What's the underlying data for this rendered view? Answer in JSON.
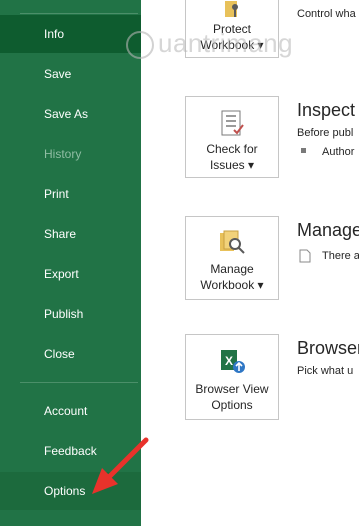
{
  "sidebar": {
    "items": [
      {
        "label": "Info"
      },
      {
        "label": "Save"
      },
      {
        "label": "Save As"
      },
      {
        "label": "History"
      },
      {
        "label": "Print"
      },
      {
        "label": "Share"
      },
      {
        "label": "Export"
      },
      {
        "label": "Publish"
      },
      {
        "label": "Close"
      },
      {
        "label": "Account"
      },
      {
        "label": "Feedback"
      },
      {
        "label": "Options"
      }
    ]
  },
  "main": {
    "protect": {
      "button_line1": "Protect",
      "button_line2": "Workbook ▾",
      "desc": "Control wha"
    },
    "inspect": {
      "button_line1": "Check for",
      "button_line2": "Issues ▾",
      "title": "Inspect",
      "desc": "Before publ",
      "bullet": "Author"
    },
    "manage": {
      "button_line1": "Manage",
      "button_line2": "Workbook ▾",
      "title": "Manage",
      "desc": "There a"
    },
    "browser": {
      "button_line1": "Browser View",
      "button_line2": "Options",
      "title": "Browser",
      "desc": "Pick what u"
    }
  },
  "watermark": "uantrimang",
  "colors": {
    "sidebar_bg": "#217346",
    "sidebar_active": "#0e5c2f",
    "arrow": "#e8322b"
  }
}
